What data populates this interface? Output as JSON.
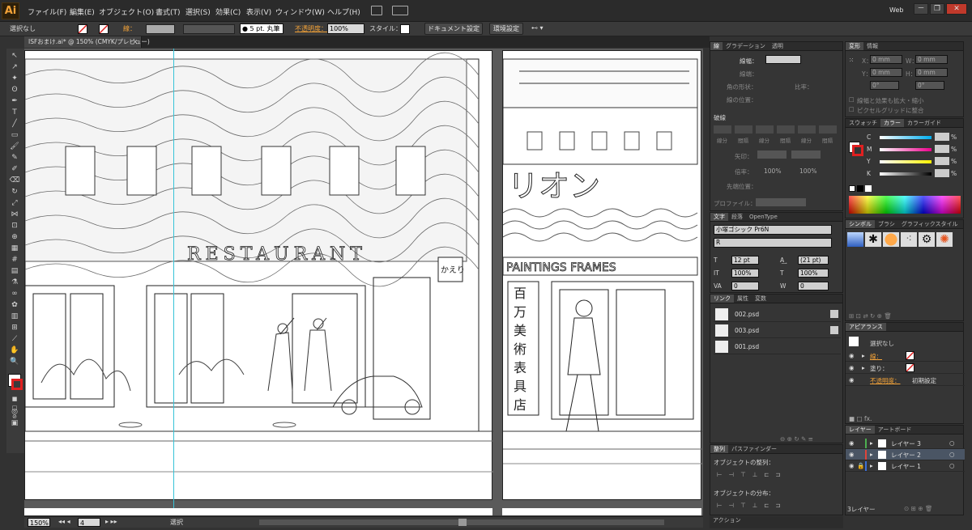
{
  "menubar": {
    "logo": "Ai",
    "items": [
      "ファイル(F)",
      "編集(E)",
      "オブジェクト(O)",
      "書式(T)",
      "選択(S)",
      "効果(C)",
      "表示(V)",
      "ウィンドウ(W)",
      "ヘルプ(H)"
    ],
    "workspace": "Web",
    "window_buttons": [
      "－",
      "❐",
      "✕"
    ]
  },
  "control_bar": {
    "selection_label": "選択なし",
    "stroke_label": "線：",
    "stroke_weight": "● 5 pt. 丸筆",
    "opacity_label": "不透明度：",
    "opacity_value": "100%",
    "style_label": "スタイル：",
    "doc_setup_btn": "ドキュメント設定",
    "preferences_btn": "環境設定"
  },
  "document": {
    "tab_title": "ISFおまけ.ai* @ 150% (CMYK/プレビュー)",
    "tab_close": "×"
  },
  "status_bar": {
    "zoom": "150%",
    "artboard_num": "4",
    "tool_status": "選択"
  },
  "artwork": {
    "left_sign": "RESTAURANT",
    "left_small_sign": "かえり",
    "right_sign": "リオン",
    "right_banner": "PAINTINGS FRAMES",
    "right_vertical_sign": [
      "百",
      "万",
      "美",
      "術",
      "表",
      "具",
      "店"
    ]
  },
  "stroke_panel": {
    "tabs": [
      "線",
      "グラデーション",
      "透明"
    ],
    "weight_label": "線幅：",
    "cap_label": "線端：",
    "corner_label": "角の形状：",
    "limit_label": "比率：",
    "align_label": "線の位置：",
    "dashed_label": "破線",
    "dash_cols": [
      "線分",
      "間隔",
      "線分",
      "間隔",
      "線分",
      "間隔"
    ],
    "arrow_label": "矢印：",
    "scale_label": "倍率：",
    "scale_value1": "100%",
    "scale_value2": "100%",
    "arrow_pos_label": "先端位置：",
    "profile_label": "プロファイル："
  },
  "char_panel": {
    "tabs": [
      "文字",
      "段落",
      "OpenType"
    ],
    "font_family": "小塚ゴシック Pr6N",
    "font_style": "R",
    "size": "12 pt",
    "leading": "(21 pt)",
    "vscale": "100%",
    "hscale": "100%",
    "kerning": "0",
    "tracking": "0"
  },
  "links_panel": {
    "tabs": [
      "リンク",
      "属性",
      "変数"
    ],
    "items": [
      "002.psd",
      "003.psd",
      "001.psd"
    ]
  },
  "align_panel": {
    "tabs": [
      "整列",
      "パスファインダー"
    ],
    "align_label": "オブジェクトの整列：",
    "distribute_label": "オブジェクトの分布：",
    "footer": "アクション"
  },
  "transform_panel": {
    "tabs": [
      "変形",
      "情報"
    ],
    "x_label": "X：",
    "x": "0 mm",
    "w_label": "W：",
    "w": "0 mm",
    "y_label": "Y：",
    "y": "0 mm",
    "h_label": "H：",
    "h": "0 mm",
    "angle": "0°",
    "shear": "0°",
    "check1": "線幅と効果も拡大・縮小",
    "check2": "ピクセルグリッドに整合"
  },
  "color_panel": {
    "tabs": [
      "スウォッチ",
      "カラー",
      "カラーガイド"
    ],
    "channels": [
      "C",
      "M",
      "Y",
      "K"
    ],
    "percent": "%"
  },
  "symbols_panel": {
    "tabs": [
      "シンボル",
      "ブラシ",
      "グラフィックスタイル"
    ]
  },
  "appearance_panel": {
    "tabs": [
      "アピアランス"
    ],
    "title": "選択なし",
    "stroke_label": "線：",
    "fill_label": "塗り：",
    "opacity_label": "不透明度：",
    "opacity_value": "初期設定",
    "fx": "fx."
  },
  "layers_panel": {
    "tabs": [
      "レイヤー",
      "アートボード"
    ],
    "layers": [
      {
        "name": "レイヤー 3",
        "color": "#4caf50"
      },
      {
        "name": "レイヤー 2",
        "color": "#e0443a"
      },
      {
        "name": "レイヤー 1",
        "color": "#3b6fd8"
      }
    ],
    "footer": "3レイヤー"
  }
}
